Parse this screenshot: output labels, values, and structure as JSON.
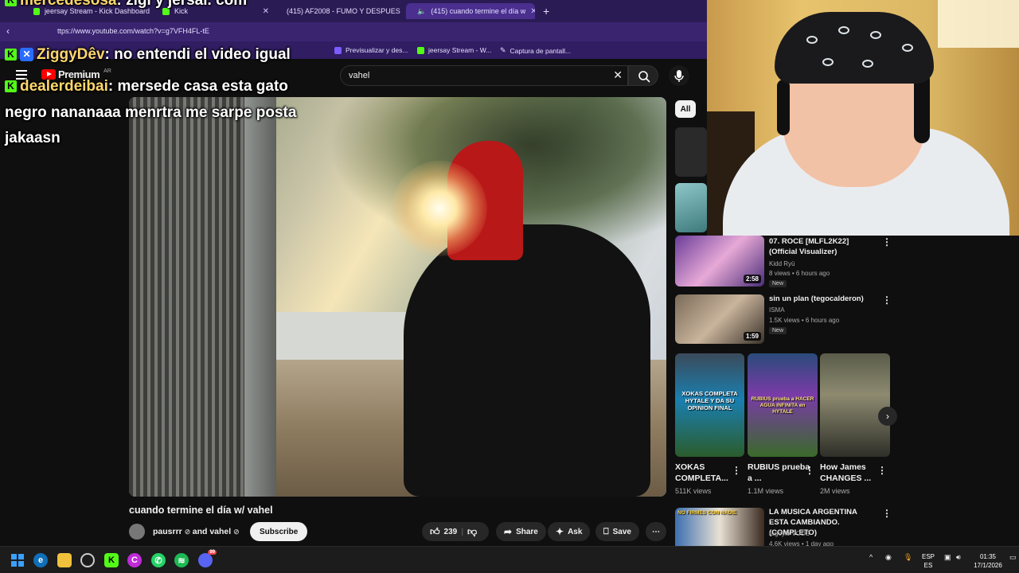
{
  "browser": {
    "tabs": [
      {
        "label": "jeersay Stream - Kick Dashboard"
      },
      {
        "label": "Kick"
      },
      {
        "label": "(415) AF2008 - FUMO Y DESPUES"
      },
      {
        "label": "(415) cuando termine el día w"
      }
    ],
    "url": "ttps://www.youtube.com/watch?v=g7VFH4FL-tE",
    "bookmarks": [
      {
        "label": "Previsualizar y des..."
      },
      {
        "label": "jeersay Stream - W..."
      },
      {
        "label": "Captura de pantall..."
      }
    ]
  },
  "youtube": {
    "logo_text": "Premium",
    "region": "AR",
    "search_value": "vahel",
    "video_title": "cuando termine el día w/ vahel",
    "channel": "pausrrr",
    "channel_joiner": "and vahel",
    "subscribe_label": "Subscribe",
    "likes": "239",
    "share_label": "Share",
    "ask_label": "Ask",
    "save_label": "Save",
    "chip_all": "All"
  },
  "recommendations": [
    {
      "title": "07. ROCE [MLFL2K22] (Official Visualizer)",
      "channel": "Kidd Ryü",
      "meta": "8 views • 6 hours ago",
      "badge": "New",
      "duration": "2:58"
    },
    {
      "title": "sin un plan (tegocalderon)",
      "channel": "ISMA",
      "meta": "1.5K views • 6 hours ago",
      "badge": "New",
      "duration": "1:59"
    }
  ],
  "shorts": [
    {
      "title": "XOKAS COMPLETA...",
      "views": "511K views",
      "thumb_text": "XOKAS COMPLETA HYTALE Y DA SU OPINION FINAL"
    },
    {
      "title": "RUBIUS prueba a ...",
      "views": "1.1M views",
      "thumb_text": "RUBIUS prueba a HACER AGUA INFINITA en HYTALE"
    },
    {
      "title": "How James CHANGES ...",
      "views": "2M views"
    }
  ],
  "recommendation_bottom": {
    "title": "LA MUSICA ARGENTINA ESTA CAMBIANDO. (COMPLETO)",
    "channel": "rageylo VODS",
    "meta": "4.6K views • 1 day ago",
    "thumb_text": "NO FIRMES CON NADIE"
  },
  "chat": [
    {
      "user": "mercedesosa",
      "message": ": zigi y jersai. com"
    },
    {
      "user": "ZiggyDêv",
      "message": ": no entendi el video igual"
    },
    {
      "user": "dealerdeibai",
      "message": ": mersede casa esta gato"
    },
    {
      "continuation": "negro nananaaa menrtra me sarpe posta"
    },
    {
      "continuation": "jakaasn"
    }
  ],
  "taskbar": {
    "lang_top": "ESP",
    "lang_bottom": "ES",
    "time": "01:35",
    "date": "17/1/2026",
    "discord_badge": "99"
  },
  "colors": {
    "youtube_bg": "#0f0f0f",
    "browser_purple": "#3a2470",
    "youtube_red": "#ff0000",
    "kick_green": "#53fc18",
    "chat_username": "#ffd86b"
  }
}
